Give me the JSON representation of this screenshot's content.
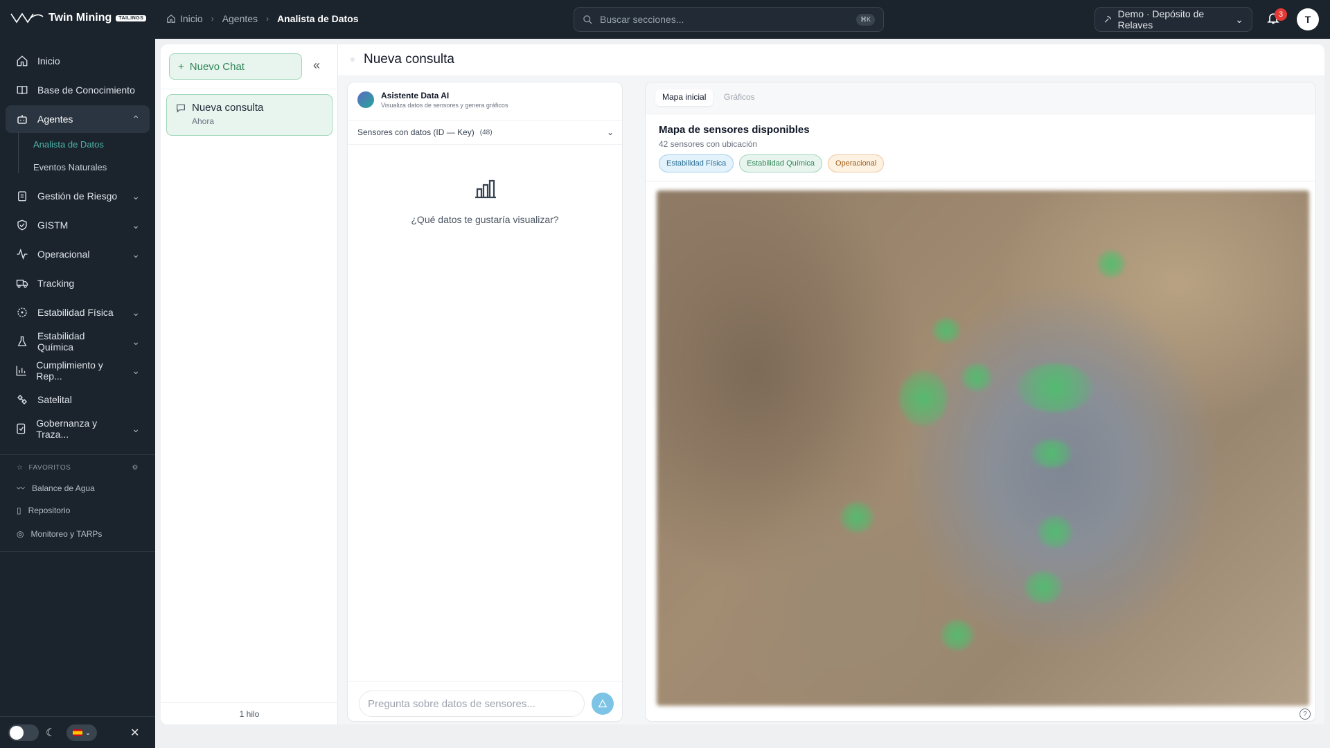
{
  "app": {
    "logo_text": "Twin Mining",
    "logo_badge": "TAILINGS",
    "accent": "#2f8557",
    "sidebar_bg": "#1b232c"
  },
  "breadcrumb": [
    "Inicio",
    "Agentes",
    "Analista de Datos"
  ],
  "search": {
    "placeholder": "Buscar secciones...",
    "shortcut": "⌘K"
  },
  "project_selector": {
    "label": "Demo · Depósito de Relaves"
  },
  "notifications": {
    "count": "3"
  },
  "user": {
    "initial": "T"
  },
  "sidebar": {
    "items": [
      {
        "label": "Inicio",
        "icon": "home-icon"
      },
      {
        "label": "Base de Conocimiento",
        "icon": "book-icon"
      },
      {
        "label": "Agentes",
        "icon": "bot-icon",
        "expanded": true
      },
      {
        "label": "Gestión de Riesgo",
        "icon": "clipboard-icon"
      },
      {
        "label": "GISTM",
        "icon": "shield-check-icon"
      },
      {
        "label": "Operacional",
        "icon": "activity-icon"
      },
      {
        "label": "Tracking",
        "icon": "truck-icon"
      },
      {
        "label": "Estabilidad Física",
        "icon": "radar-icon"
      },
      {
        "label": "Estabilidad Química",
        "icon": "flask-icon"
      },
      {
        "label": "Cumplimiento y Rep...",
        "icon": "bar-chart-icon"
      },
      {
        "label": "Satelital",
        "icon": "satellite-icon"
      },
      {
        "label": "Gobernanza y Traza...",
        "icon": "file-check-icon"
      }
    ],
    "sub_items": [
      "Analista de Datos",
      "Eventos Naturales"
    ],
    "favorites_title": "FAVORITOS",
    "favorites": [
      "Balance de Agua",
      "Repositorio",
      "Monitoreo y TARPs"
    ]
  },
  "threads": {
    "new_chat_label": "Nuevo Chat",
    "items": [
      {
        "title": "Nueva consulta",
        "time": "Ahora"
      }
    ],
    "footer": "1 hilo"
  },
  "main": {
    "title": "Nueva consulta",
    "assistant": {
      "name": "Asistente Data AI",
      "description": "Visualiza datos de sensores y genera gráficos"
    },
    "sensors_label": "Sensores con datos (ID — Key)",
    "sensors_count": "(48)",
    "empty_prompt": "¿Qué datos te gustaría visualizar?",
    "input_placeholder": "Pregunta sobre datos de sensores..."
  },
  "map_panel": {
    "tabs": [
      "Mapa inicial",
      "Gráficos"
    ],
    "active_tab": "Mapa inicial",
    "title": "Mapa de sensores disponibles",
    "subtitle": "42 sensores con ubicación",
    "chips": [
      "Estabilidad Física",
      "Estabilidad Química",
      "Operacional"
    ]
  }
}
